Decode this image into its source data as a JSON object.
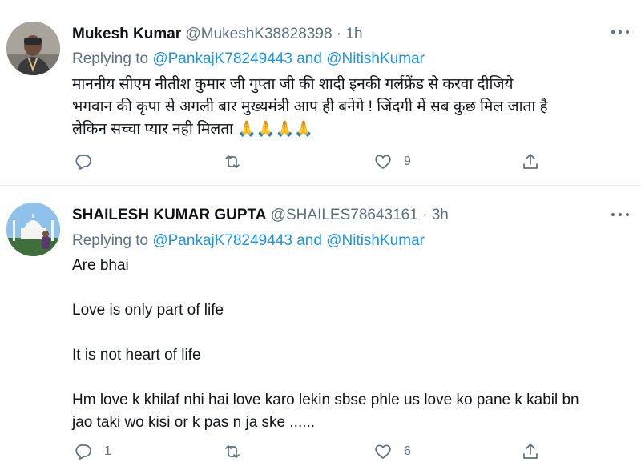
{
  "tweets": [
    {
      "name": "Mukesh Kumar",
      "handle": "@MukeshK38828398",
      "separator": "·",
      "time": "1h",
      "replying_prefix": "Replying to",
      "replying_mention_1": "@PankajK78249443",
      "replying_and": "and",
      "replying_mention_2": "@NitishKumar",
      "lines": [
        "माननीय सीएम नीतीश कुमार जी गुप्ता जी की शादी इनकी गर्लफ्रेंड से करवा दीजिये",
        "भगवान की कृपा से अगली बार मुख्यमंत्री आप ही बनेगे ! जिंदगी में सब कुछ मिल जाता है",
        "लेकिन सच्चा प्यार नही मिलता 🙏🙏🙏🙏"
      ],
      "reply_count": "",
      "retweet_count": "",
      "like_count": "9"
    },
    {
      "name": "SHAILESH KUMAR GUPTA",
      "handle": "@SHAILES78643161",
      "separator": "·",
      "time": "3h",
      "replying_prefix": "Replying to",
      "replying_mention_1": "@PankajK78249443",
      "replying_and": "and",
      "replying_mention_2": "@NitishKumar",
      "lines": [
        "Are bhai",
        "",
        "Love is only part of life",
        "",
        "It is not heart of life",
        "",
        "Hm love k khilaf nhi hai love karo lekin sbse phle us love ko pane k kabil bn",
        "jao taki wo kisi or k pas n ja ske ......"
      ],
      "reply_count": "1",
      "retweet_count": "",
      "like_count": "6"
    }
  ],
  "icons": {
    "more": "more-horizontal-icon",
    "reply": "reply-bubble-icon",
    "retweet": "retweet-icon",
    "like": "heart-icon",
    "share": "share-icon"
  },
  "colors": {
    "text": "#0f1419",
    "secondary": "#5b7083",
    "link": "#1b95e0",
    "divider": "#e6ecf0"
  }
}
